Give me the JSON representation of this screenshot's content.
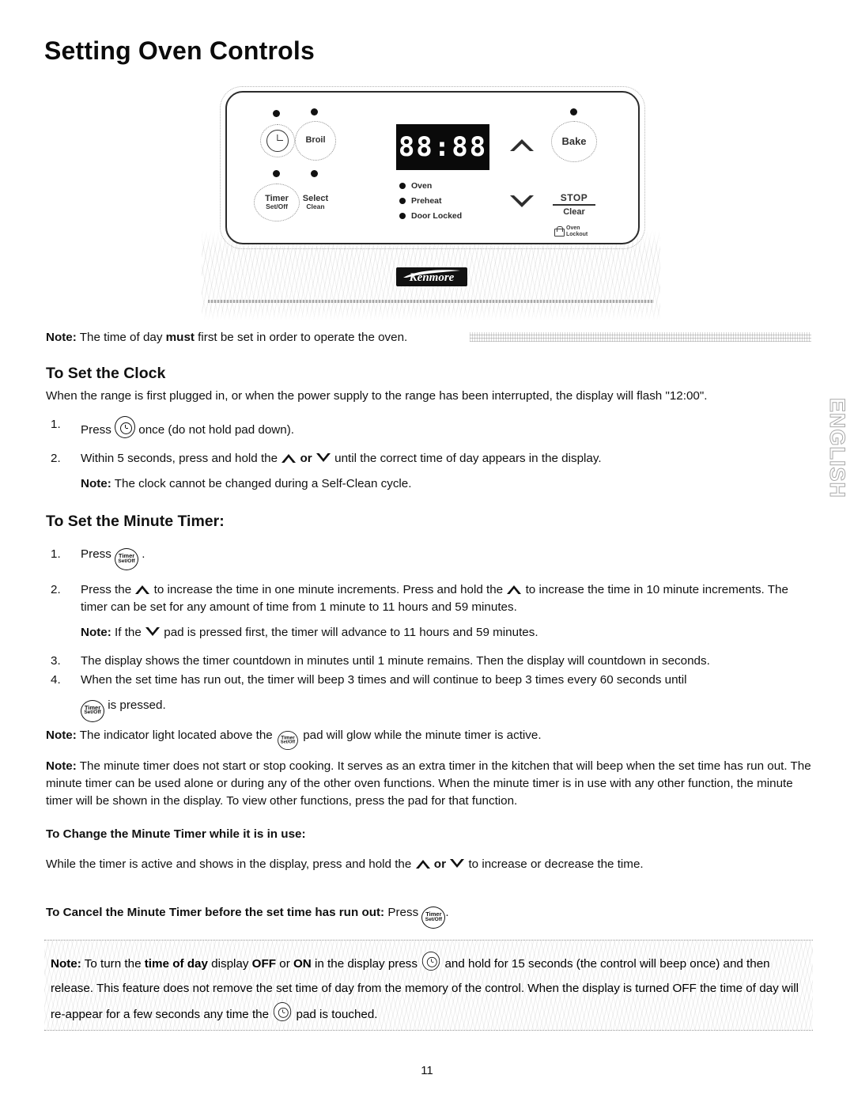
{
  "page": {
    "title": "Setting Oven Controls",
    "page_number": "11",
    "side_tab": "ENGLISH"
  },
  "control_panel": {
    "brand": "Kenmore",
    "display_value": "88:88",
    "indicators": [
      {
        "label": "Oven"
      },
      {
        "label": "Preheat"
      },
      {
        "label": "Door Locked"
      }
    ],
    "pads": {
      "clock": {
        "icon": "clock-icon",
        "label": ""
      },
      "broil": {
        "label": "Broil"
      },
      "timer": {
        "label_line1": "Timer",
        "label_line2": "Set/Off"
      },
      "select": {
        "label_line1": "Select",
        "label_line2": "Clean"
      },
      "bake": {
        "label": "Bake"
      },
      "up": {
        "icon": "chevron-up-icon"
      },
      "down": {
        "icon": "chevron-down-icon"
      },
      "stop_clear": {
        "line1": "STOP",
        "line2": "Clear"
      },
      "oven_lockout": {
        "line1": "Oven",
        "line2": "Lockout",
        "icon": "padlock-icon"
      }
    }
  },
  "content": {
    "top_note": {
      "label": "Note:",
      "text_a": " The time of day ",
      "bold": "must",
      "text_b": " first be set in order to operate the oven."
    },
    "clock_section": {
      "heading": "To Set the Clock",
      "intro": "When the range is first plugged in, or when the power supply to the range has been interrupted, the display will flash \"12:00\".",
      "step1": {
        "num": "1.",
        "text_a": "Press ",
        "text_b": " once (do not hold pad down)."
      },
      "step2": {
        "num": "2.",
        "text_a": "Within 5 seconds, press and hold the ",
        "or": "or",
        "text_b": " until the correct time of day appears in the display."
      },
      "step2_note": {
        "label": "Note:",
        "text": " The clock cannot be changed during a Self-Clean cycle."
      }
    },
    "timer_section": {
      "heading": "To Set the Minute Timer:",
      "step1": {
        "num": "1.",
        "text_a": "Press ",
        "text_b": " ."
      },
      "step2": {
        "num": "2.",
        "text_a": "Press the ",
        "text_b": " to increase the time in one minute increments. Press and hold the ",
        "text_c": " to increase the time in 10 minute increments. The timer can be set for any amount of time from 1 minute to 11 hours and 59 minutes."
      },
      "step2_note": {
        "label": "Note:",
        "text_a": " If the ",
        "text_b": " pad is pressed first, the timer will advance to 11 hours and 59 minutes."
      },
      "step3": {
        "num": "3.",
        "text": "The display shows the timer countdown in minutes until 1 minute remains. Then the display will countdown in seconds."
      },
      "step4": {
        "num": "4.",
        "text_a": "When the set time has run out, the timer will beep 3 times and will continue to beep 3 times every 60 seconds until ",
        "text_b": " is pressed."
      },
      "note_indicator": {
        "label": "Note:",
        "text_a": " The indicator light located above the ",
        "text_b": " pad will glow while the minute timer is active."
      },
      "note_long": {
        "label": "Note:",
        "text": " The minute timer does not start or stop cooking. It serves as an extra timer in the kitchen that will beep when the set time has run out. The minute timer can be used alone or during any of the other oven functions. When the minute timer is in use with any other function, the minute timer will be shown in the display. To view other functions, press the pad for that function."
      }
    },
    "change_timer": {
      "heading": "To Change the Minute Timer while it is in use:",
      "text_a": "While the timer is active and shows in the display, press and hold the ",
      "or": "or",
      "text_b": " to increase or decrease the time."
    },
    "cancel_timer": {
      "heading": "To Cancel the Minute Timer before the set time has run out:",
      "text_a": " Press ",
      "text_b": "."
    },
    "bottom_note": {
      "label": "Note:",
      "text_a": " To turn the ",
      "bold_a": "time of day",
      "text_b": " display ",
      "bold_b": "OFF",
      "text_c": " or ",
      "bold_c": "ON",
      "text_d": " in the display press ",
      "text_e": " and hold for 15 seconds (the control will beep once) and then release. This feature does not remove the set time of day from the memory of the control. When the display is turned OFF the time of day will re-appear for a few seconds any time the ",
      "text_f": " pad is touched."
    }
  }
}
